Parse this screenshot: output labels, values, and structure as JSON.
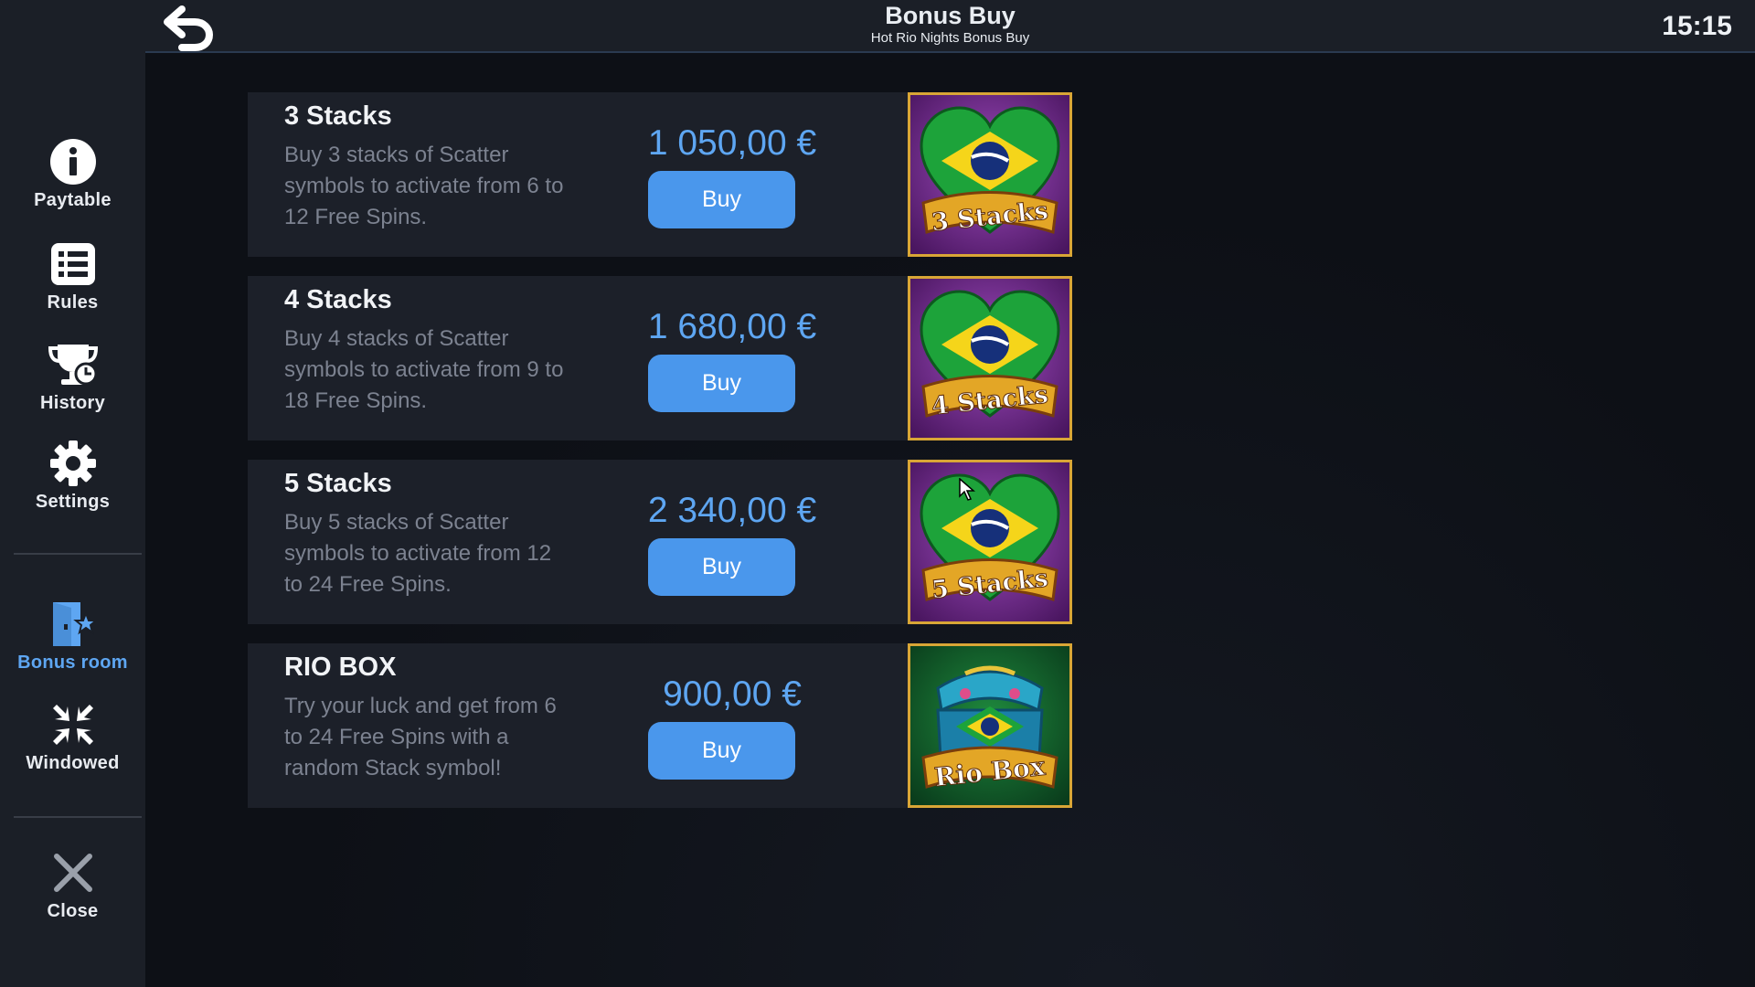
{
  "header": {
    "title": "Bonus Buy",
    "subtitle": "Hot Rio Nights Bonus Buy",
    "clock": "15:15"
  },
  "sidebar": {
    "items": [
      {
        "label": "Paytable",
        "icon": "info-icon"
      },
      {
        "label": "Rules",
        "icon": "list-icon"
      },
      {
        "label": "History",
        "icon": "trophy-clock-icon"
      },
      {
        "label": "Settings",
        "icon": "gear-icon"
      },
      {
        "label": "Bonus room",
        "icon": "door-star-icon",
        "active": true
      },
      {
        "label": "Windowed",
        "icon": "minimize-icon"
      },
      {
        "label": "Close",
        "icon": "close-icon"
      }
    ]
  },
  "offers": [
    {
      "name": "3 Stacks",
      "desc": "Buy 3 stacks of Scatter symbols to activate from 6 to 12 Free Spins.",
      "price": "1 050,00 €",
      "button": "Buy",
      "badge": "3 Stacks"
    },
    {
      "name": "4 Stacks",
      "desc": "Buy 4 stacks of Scatter symbols to activate from 9 to 18 Free Spins.",
      "price": "1 680,00 €",
      "button": "Buy",
      "badge": "4 Stacks"
    },
    {
      "name": "5 Stacks",
      "desc": "Buy 5 stacks of Scatter symbols to activate from 12 to 24 Free Spins.",
      "price": "2 340,00 €",
      "button": "Buy",
      "badge": "5 Stacks"
    },
    {
      "name": "RIO BOX",
      "desc": "Try your luck and get from 6 to 24 Free Spins with a random Stack symbol!",
      "price": "900,00 €",
      "button": "Buy",
      "badge": "Rio Box"
    }
  ],
  "colors": {
    "accent": "#4a97ec",
    "price": "#5ea6f2",
    "panel": "#1c2029",
    "background": "#0d1016",
    "frame_gold": "#d9a636"
  }
}
